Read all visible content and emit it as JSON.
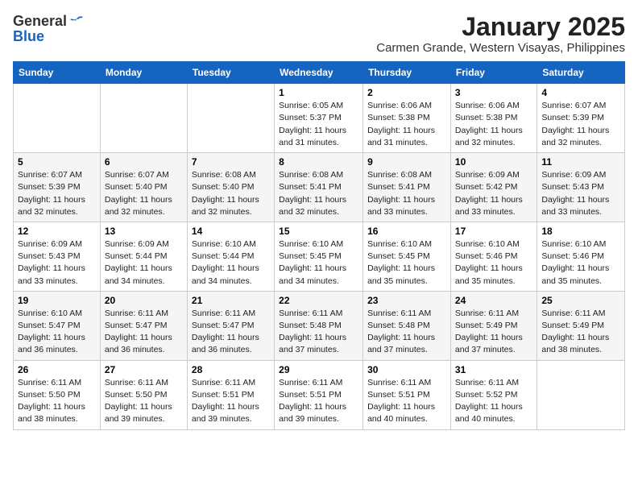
{
  "header": {
    "logo_general": "General",
    "logo_blue": "Blue",
    "month": "January 2025",
    "location": "Carmen Grande, Western Visayas, Philippines"
  },
  "weekdays": [
    "Sunday",
    "Monday",
    "Tuesday",
    "Wednesday",
    "Thursday",
    "Friday",
    "Saturday"
  ],
  "weeks": [
    [
      {
        "day": "",
        "info": ""
      },
      {
        "day": "",
        "info": ""
      },
      {
        "day": "",
        "info": ""
      },
      {
        "day": "1",
        "info": "Sunrise: 6:05 AM\nSunset: 5:37 PM\nDaylight: 11 hours\nand 31 minutes."
      },
      {
        "day": "2",
        "info": "Sunrise: 6:06 AM\nSunset: 5:38 PM\nDaylight: 11 hours\nand 31 minutes."
      },
      {
        "day": "3",
        "info": "Sunrise: 6:06 AM\nSunset: 5:38 PM\nDaylight: 11 hours\nand 32 minutes."
      },
      {
        "day": "4",
        "info": "Sunrise: 6:07 AM\nSunset: 5:39 PM\nDaylight: 11 hours\nand 32 minutes."
      }
    ],
    [
      {
        "day": "5",
        "info": "Sunrise: 6:07 AM\nSunset: 5:39 PM\nDaylight: 11 hours\nand 32 minutes."
      },
      {
        "day": "6",
        "info": "Sunrise: 6:07 AM\nSunset: 5:40 PM\nDaylight: 11 hours\nand 32 minutes."
      },
      {
        "day": "7",
        "info": "Sunrise: 6:08 AM\nSunset: 5:40 PM\nDaylight: 11 hours\nand 32 minutes."
      },
      {
        "day": "8",
        "info": "Sunrise: 6:08 AM\nSunset: 5:41 PM\nDaylight: 11 hours\nand 32 minutes."
      },
      {
        "day": "9",
        "info": "Sunrise: 6:08 AM\nSunset: 5:41 PM\nDaylight: 11 hours\nand 33 minutes."
      },
      {
        "day": "10",
        "info": "Sunrise: 6:09 AM\nSunset: 5:42 PM\nDaylight: 11 hours\nand 33 minutes."
      },
      {
        "day": "11",
        "info": "Sunrise: 6:09 AM\nSunset: 5:43 PM\nDaylight: 11 hours\nand 33 minutes."
      }
    ],
    [
      {
        "day": "12",
        "info": "Sunrise: 6:09 AM\nSunset: 5:43 PM\nDaylight: 11 hours\nand 33 minutes."
      },
      {
        "day": "13",
        "info": "Sunrise: 6:09 AM\nSunset: 5:44 PM\nDaylight: 11 hours\nand 34 minutes."
      },
      {
        "day": "14",
        "info": "Sunrise: 6:10 AM\nSunset: 5:44 PM\nDaylight: 11 hours\nand 34 minutes."
      },
      {
        "day": "15",
        "info": "Sunrise: 6:10 AM\nSunset: 5:45 PM\nDaylight: 11 hours\nand 34 minutes."
      },
      {
        "day": "16",
        "info": "Sunrise: 6:10 AM\nSunset: 5:45 PM\nDaylight: 11 hours\nand 35 minutes."
      },
      {
        "day": "17",
        "info": "Sunrise: 6:10 AM\nSunset: 5:46 PM\nDaylight: 11 hours\nand 35 minutes."
      },
      {
        "day": "18",
        "info": "Sunrise: 6:10 AM\nSunset: 5:46 PM\nDaylight: 11 hours\nand 35 minutes."
      }
    ],
    [
      {
        "day": "19",
        "info": "Sunrise: 6:10 AM\nSunset: 5:47 PM\nDaylight: 11 hours\nand 36 minutes."
      },
      {
        "day": "20",
        "info": "Sunrise: 6:11 AM\nSunset: 5:47 PM\nDaylight: 11 hours\nand 36 minutes."
      },
      {
        "day": "21",
        "info": "Sunrise: 6:11 AM\nSunset: 5:47 PM\nDaylight: 11 hours\nand 36 minutes."
      },
      {
        "day": "22",
        "info": "Sunrise: 6:11 AM\nSunset: 5:48 PM\nDaylight: 11 hours\nand 37 minutes."
      },
      {
        "day": "23",
        "info": "Sunrise: 6:11 AM\nSunset: 5:48 PM\nDaylight: 11 hours\nand 37 minutes."
      },
      {
        "day": "24",
        "info": "Sunrise: 6:11 AM\nSunset: 5:49 PM\nDaylight: 11 hours\nand 37 minutes."
      },
      {
        "day": "25",
        "info": "Sunrise: 6:11 AM\nSunset: 5:49 PM\nDaylight: 11 hours\nand 38 minutes."
      }
    ],
    [
      {
        "day": "26",
        "info": "Sunrise: 6:11 AM\nSunset: 5:50 PM\nDaylight: 11 hours\nand 38 minutes."
      },
      {
        "day": "27",
        "info": "Sunrise: 6:11 AM\nSunset: 5:50 PM\nDaylight: 11 hours\nand 39 minutes."
      },
      {
        "day": "28",
        "info": "Sunrise: 6:11 AM\nSunset: 5:51 PM\nDaylight: 11 hours\nand 39 minutes."
      },
      {
        "day": "29",
        "info": "Sunrise: 6:11 AM\nSunset: 5:51 PM\nDaylight: 11 hours\nand 39 minutes."
      },
      {
        "day": "30",
        "info": "Sunrise: 6:11 AM\nSunset: 5:51 PM\nDaylight: 11 hours\nand 40 minutes."
      },
      {
        "day": "31",
        "info": "Sunrise: 6:11 AM\nSunset: 5:52 PM\nDaylight: 11 hours\nand 40 minutes."
      },
      {
        "day": "",
        "info": ""
      }
    ]
  ]
}
